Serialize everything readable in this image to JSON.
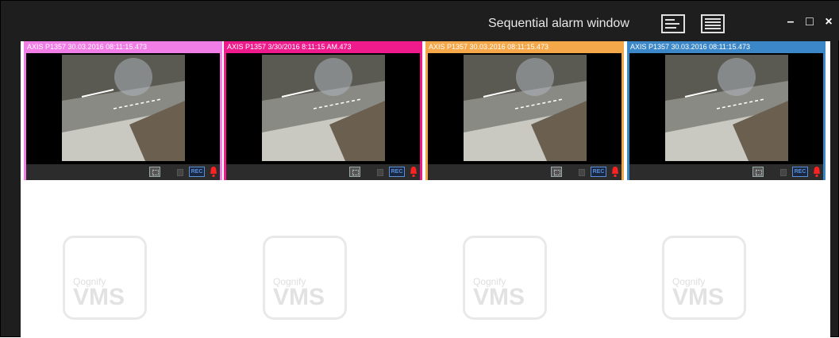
{
  "window": {
    "title": "Sequential alarm window",
    "minimize_label": "–",
    "maximize_label": "□",
    "close_label": "×"
  },
  "tiles": [
    {
      "header": "AXIS P1357 30.03.2016 08:11:15.473",
      "color": "#f07ee6",
      "rec_label": "REC"
    },
    {
      "header": "AXIS P1357 3/30/2016 8:11:15 AM.473",
      "color": "#ef1a8c",
      "rec_label": "REC"
    },
    {
      "header": "AXIS P1357 30.03.2016 08:11:15.473",
      "color": "#f5a84a",
      "rec_label": "REC"
    },
    {
      "header": "AXIS P1357 30.03.2016 08:11:15.473",
      "color": "#3c87c8",
      "rec_label": "REC"
    }
  ],
  "placeholders": [
    {
      "brand": "Qognify",
      "product": "VMS"
    },
    {
      "brand": "Qognify",
      "product": "VMS"
    },
    {
      "brand": "Qognify",
      "product": "VMS"
    },
    {
      "brand": "Qognify",
      "product": "VMS"
    }
  ],
  "icons": [
    "layout-list-icon",
    "layout-grid-icon",
    "minimize-icon",
    "maximize-icon",
    "close-icon",
    "fullscreen-icon",
    "lock-icon",
    "alarm-icon"
  ]
}
